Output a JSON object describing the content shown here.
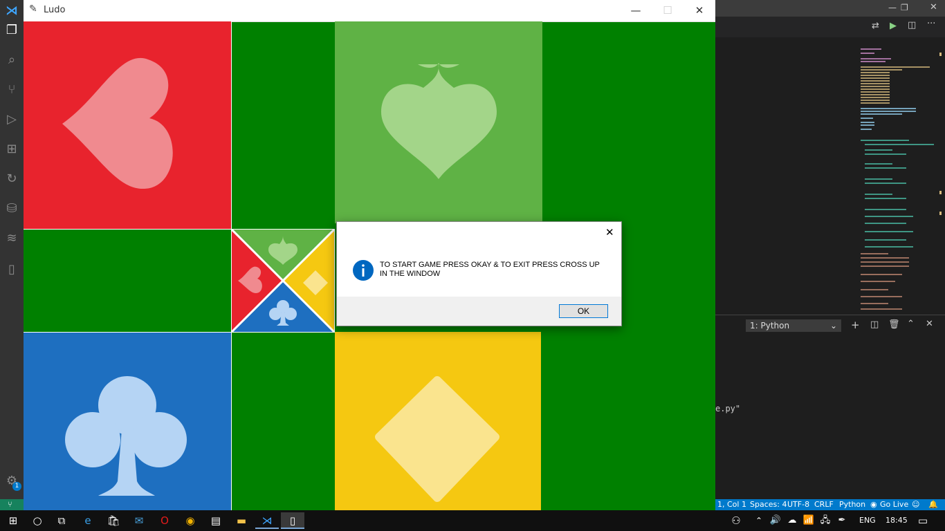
{
  "ludo": {
    "title": "Ludo",
    "minimize_glyph": "—",
    "maximize_glyph": "☐",
    "close_glyph": "✕",
    "board": {
      "colors": {
        "green_bg": "#008000",
        "red": "#e8232d",
        "green": "#5fb245",
        "blue": "#1e6fc0",
        "yellow": "#f5c811"
      },
      "suits": {
        "red": "heart-icon",
        "green": "spade-icon",
        "blue": "club-icon",
        "yellow": "diamond-icon"
      }
    }
  },
  "dialog": {
    "message": "TO START GAME PRESS OKAY & TO EXIT PRESS CROSS UP IN THE WINDOW",
    "ok_label": "OK",
    "icon": "info-icon",
    "close_glyph": "✕"
  },
  "vscode": {
    "panel_dropdown": "1: Python",
    "terminal_fragment": "e.py\"",
    "status": {
      "position": "1, Col 1",
      "spaces": "Spaces: 4",
      "encoding": "UTF-8",
      "eol": "CRLF",
      "language": "Python",
      "go_live": "Go Live"
    },
    "notification_count": "1"
  },
  "taskbar": {
    "language": "ENG",
    "time": "18:45"
  }
}
